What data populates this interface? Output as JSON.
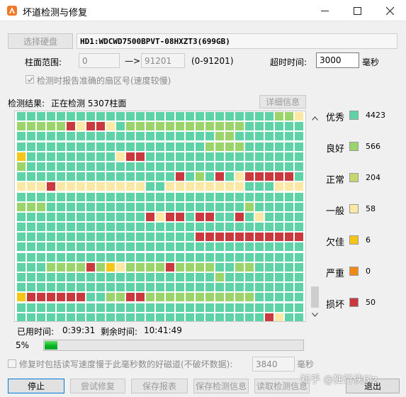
{
  "window": {
    "title": "坏道检测与修复",
    "icon": "app-logo-icon",
    "controls": [
      "minimize-icon",
      "maximize-icon",
      "close-icon"
    ]
  },
  "disk": {
    "select_button": "选择硬盘",
    "name": "HD1:WDCWD7500BPVT-08HXZT3(699GB)"
  },
  "range": {
    "label": "柱面范围:",
    "start": "0",
    "arrow": "—>",
    "end": "91201",
    "hint": "(0-91201)"
  },
  "timeout": {
    "label": "超时时间:",
    "value": "3000",
    "unit": "毫秒"
  },
  "options": {
    "report_sector": "检测时报告准确的扇区号(速度较慢)",
    "report_sector_checked": true,
    "repair_slow": "修复时包括读写速度慢于此毫秒数的好磁道(不破坏数据):",
    "repair_slow_checked": false,
    "repair_slow_value": "3840",
    "repair_slow_unit": "毫秒"
  },
  "status": {
    "label": "检测结果:",
    "text": "正在检测 5307柱面",
    "details_button": "详细信息",
    "elapsed_label": "已用时间:",
    "elapsed": "0:39:31",
    "remaining_label": "剩余时间:",
    "remaining": "10:41:49",
    "progress_text": "5%",
    "progress": 0.05
  },
  "colors": {
    "excellent": "#5fd3a8",
    "good": "#9bd46a",
    "normal": "#c7d66f",
    "fair": "#fae8a4",
    "poor": "#f5c518",
    "severe": "#ef8a18",
    "bad": "#c9393d"
  },
  "legend": [
    {
      "label": "优秀",
      "count": "4423",
      "key": "excellent"
    },
    {
      "label": "良好",
      "count": "566",
      "key": "good"
    },
    {
      "label": "正常",
      "count": "204",
      "key": "normal"
    },
    {
      "label": "一般",
      "count": "58",
      "key": "fair"
    },
    {
      "label": "欠佳",
      "count": "6",
      "key": "poor"
    },
    {
      "label": "严重",
      "count": "0",
      "key": "severe"
    },
    {
      "label": "损坏",
      "count": "50",
      "key": "bad"
    }
  ],
  "grid_legend_code": "E=excellent G=good N=normal F=fair P=poor S=severe B=bad",
  "grid_rows": [
    "EEEEEEEEEEEEEEEEEEEEEEEEEEGGF",
    "GGGGGBFBBFEGGGGGGGGGGGGEEEEEE",
    "EEEEEEEEEEEEEEEEEEEEGGEEEEEEE",
    "EEEEEEEEEEEEEEEEEEEGGGGEEEEEE",
    "PEEEEEEEEEFBBEEEEEEEEEEEEEEEE",
    "GEEEEEEEEEEEEEEEEEEEEEEEEEEEE",
    "EEEEEEEEEEEEEEEEBEGEBEFBBBBBE",
    "FFFBFFFFFFFFFEEFFFFFFFFEEEFFF",
    "EEEEEEEEEEEEEEEEEEEEEEEEEEEEE",
    "GGGEEEEEEEEEEEEEEEEEEEEGEEEEE",
    "EEEEEEEEEEEEEBFBBEBBEEBEFEEEE",
    "EEEEEEEEEEEEEEEEEEEEEEEEEEEEE",
    "EEEEEEEEEEEEEEEEEEBBBBBBBBBBB",
    "EEEEEEEEEEEEEEEEEEEEEEEEEEEEE",
    "EEEEEEEEEEEEEEEEEEEEEEEEEEEEE",
    "EEEGGGGBGPFGGGGBGGGGEEGGEEEEE",
    "EEEEEEEEEEEEEEEEEEEEGEEEEEEEE",
    "EEEEEEEEEEEEEEEEEEEEEEEEEEEEE",
    "PBBBBBBEEGGBBGGGGGGGGGGGEEEEE",
    "EEEEEEEEEEEEEEEEEEEEEEEEEEEEE",
    "EEEEEEEEEEEEEEEEEEEEEEEEEBFEE"
  ],
  "buttons": {
    "stop": "停止",
    "try_repair": "尝试修复",
    "save_report": "保存报表",
    "save_info": "保存检测信息",
    "load_info": "读取检测信息",
    "exit": "退出"
  },
  "watermark": "知乎 @独行侠6lz"
}
